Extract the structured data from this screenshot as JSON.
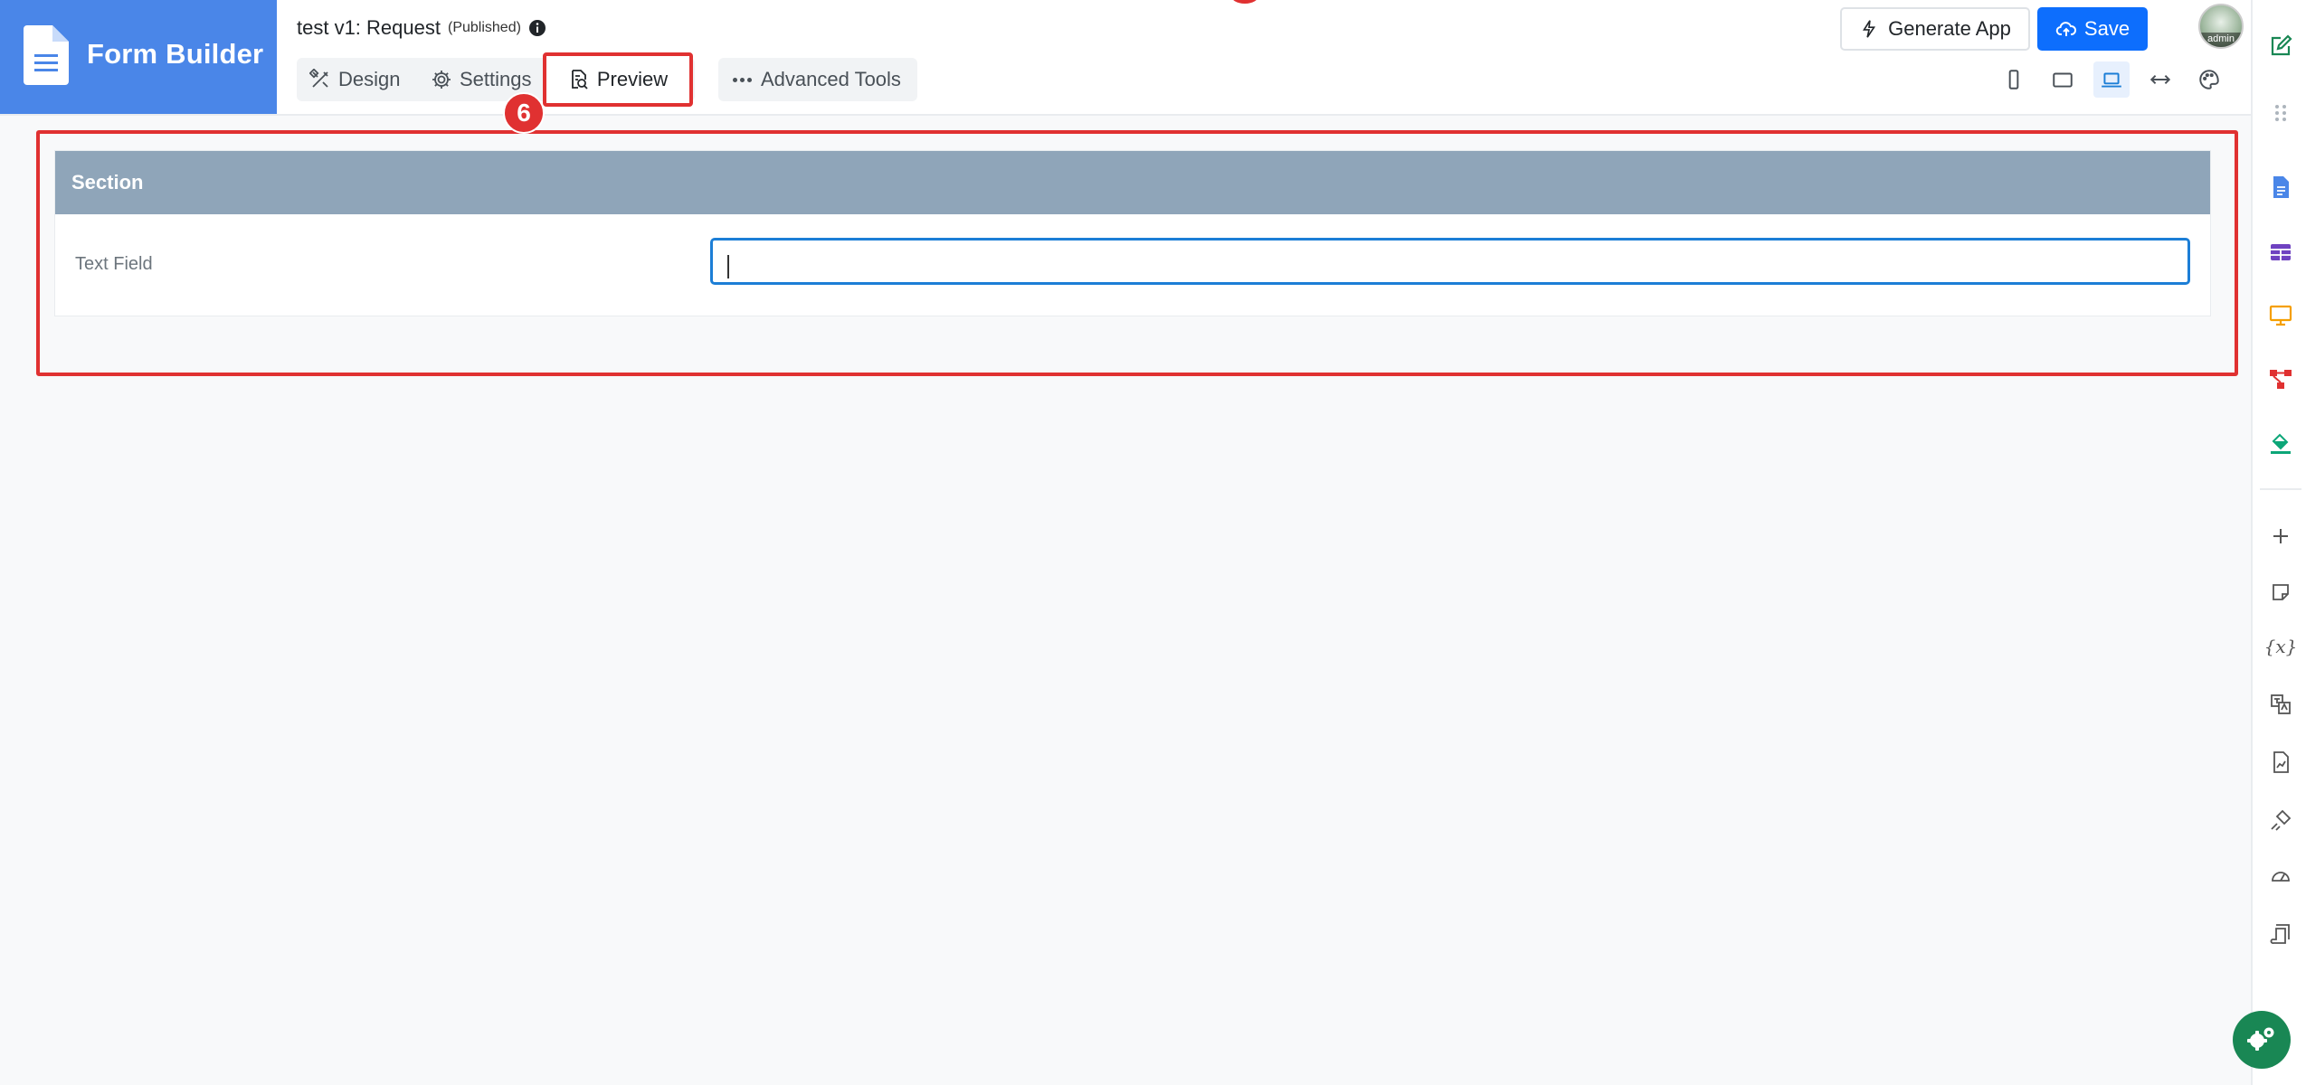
{
  "brand": {
    "title": "Form Builder"
  },
  "form": {
    "title": "test v1: Request",
    "status": "(Published)"
  },
  "tabs": [
    {
      "label": "Design",
      "icon": "design-tools-icon"
    },
    {
      "label": "Settings",
      "icon": "gear-icon"
    },
    {
      "label": "Preview",
      "icon": "preview-document-icon"
    }
  ],
  "advanced_tools": {
    "label": "Advanced Tools"
  },
  "step_badge": "6",
  "actions": {
    "generate_label": "Generate App",
    "save_label": "Save"
  },
  "avatar": {
    "label": "admin"
  },
  "view_modes": [
    "mobile",
    "tablet",
    "laptop",
    "full-width",
    "theme"
  ],
  "active_view_mode": "laptop",
  "right_toolbar": [
    "edit-form-icon",
    "drag-handle-icon",
    "document-icon",
    "table-icon",
    "monitor-icon",
    "workflow-icon",
    "paint-bucket-icon",
    "plus-icon",
    "note-icon",
    "variable-icon",
    "translate-icon",
    "report-icon",
    "plugin-icon",
    "dashboard-icon",
    "script-icon",
    "settings-gears-icon"
  ],
  "variable_label": "{x}",
  "section": {
    "title": "Section"
  },
  "field": {
    "label": "Text Field",
    "value": ""
  },
  "colors": {
    "brand": "#4a86e8",
    "primary": "#0d6efd",
    "highlight": "#e03131",
    "section_header": "#8fa5b9",
    "fab": "#198754"
  }
}
